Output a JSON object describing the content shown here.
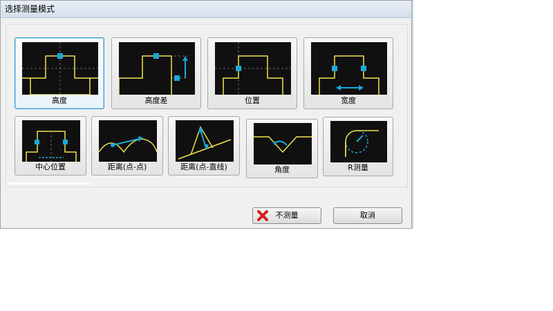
{
  "window": {
    "title": "选择测量模式"
  },
  "modes": [
    {
      "label": "高度"
    },
    {
      "label": "高度差"
    },
    {
      "label": "位置"
    },
    {
      "label": "宽度"
    },
    {
      "label": "中心位置"
    },
    {
      "label": "距离(点-点)"
    },
    {
      "label": "距离(点-直线)"
    },
    {
      "label": "角度"
    },
    {
      "label": "R测量"
    }
  ],
  "buttons": {
    "no_measure": "不测量",
    "cancel": "取消"
  },
  "colors": {
    "icon_bg": "#101010",
    "profile": "#f2e24a",
    "marker": "#1aa8d8",
    "selected_border": "#3c9bd6"
  }
}
